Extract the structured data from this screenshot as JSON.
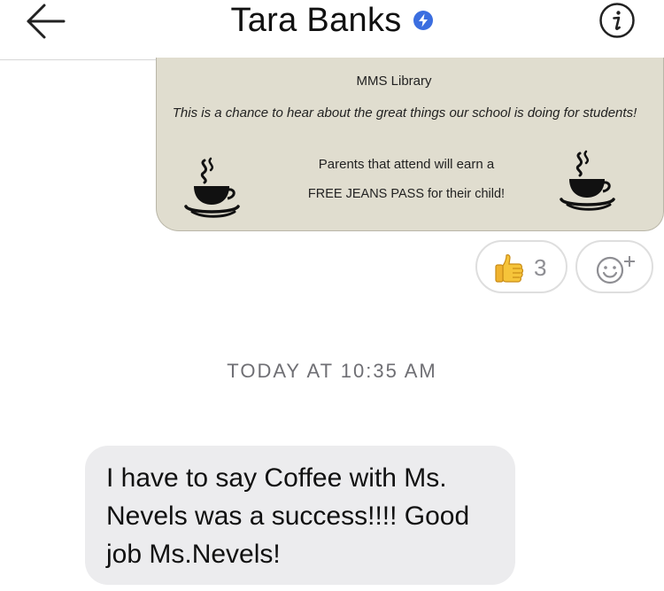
{
  "header": {
    "title": "Tara Banks",
    "back_icon": "arrow-left-icon",
    "badge_icon": "messenger-lightning-badge-icon",
    "info_icon": "info-icon",
    "badge_color": "#3b6ee0"
  },
  "flyer": {
    "title": "MMS Library",
    "intro": "This is a chance to hear about the great things our school is doing for students!",
    "line1": "Parents that attend will earn a",
    "line2": "FREE JEANS PASS for their child!",
    "decor_icon": "coffee-cup-icon",
    "background": "#e0ddcf"
  },
  "reactions": {
    "emoji": "👍",
    "emoji_icon": "thumbs-up-icon",
    "count": "3",
    "add_icon": "add-reaction-icon"
  },
  "timestamp": "TODAY AT 10:35 AM",
  "message": {
    "text": "I have to say Coffee with Ms. Nevels was a success!!!! Good job Ms.Nevels!",
    "bubble_color": "#ececee"
  }
}
